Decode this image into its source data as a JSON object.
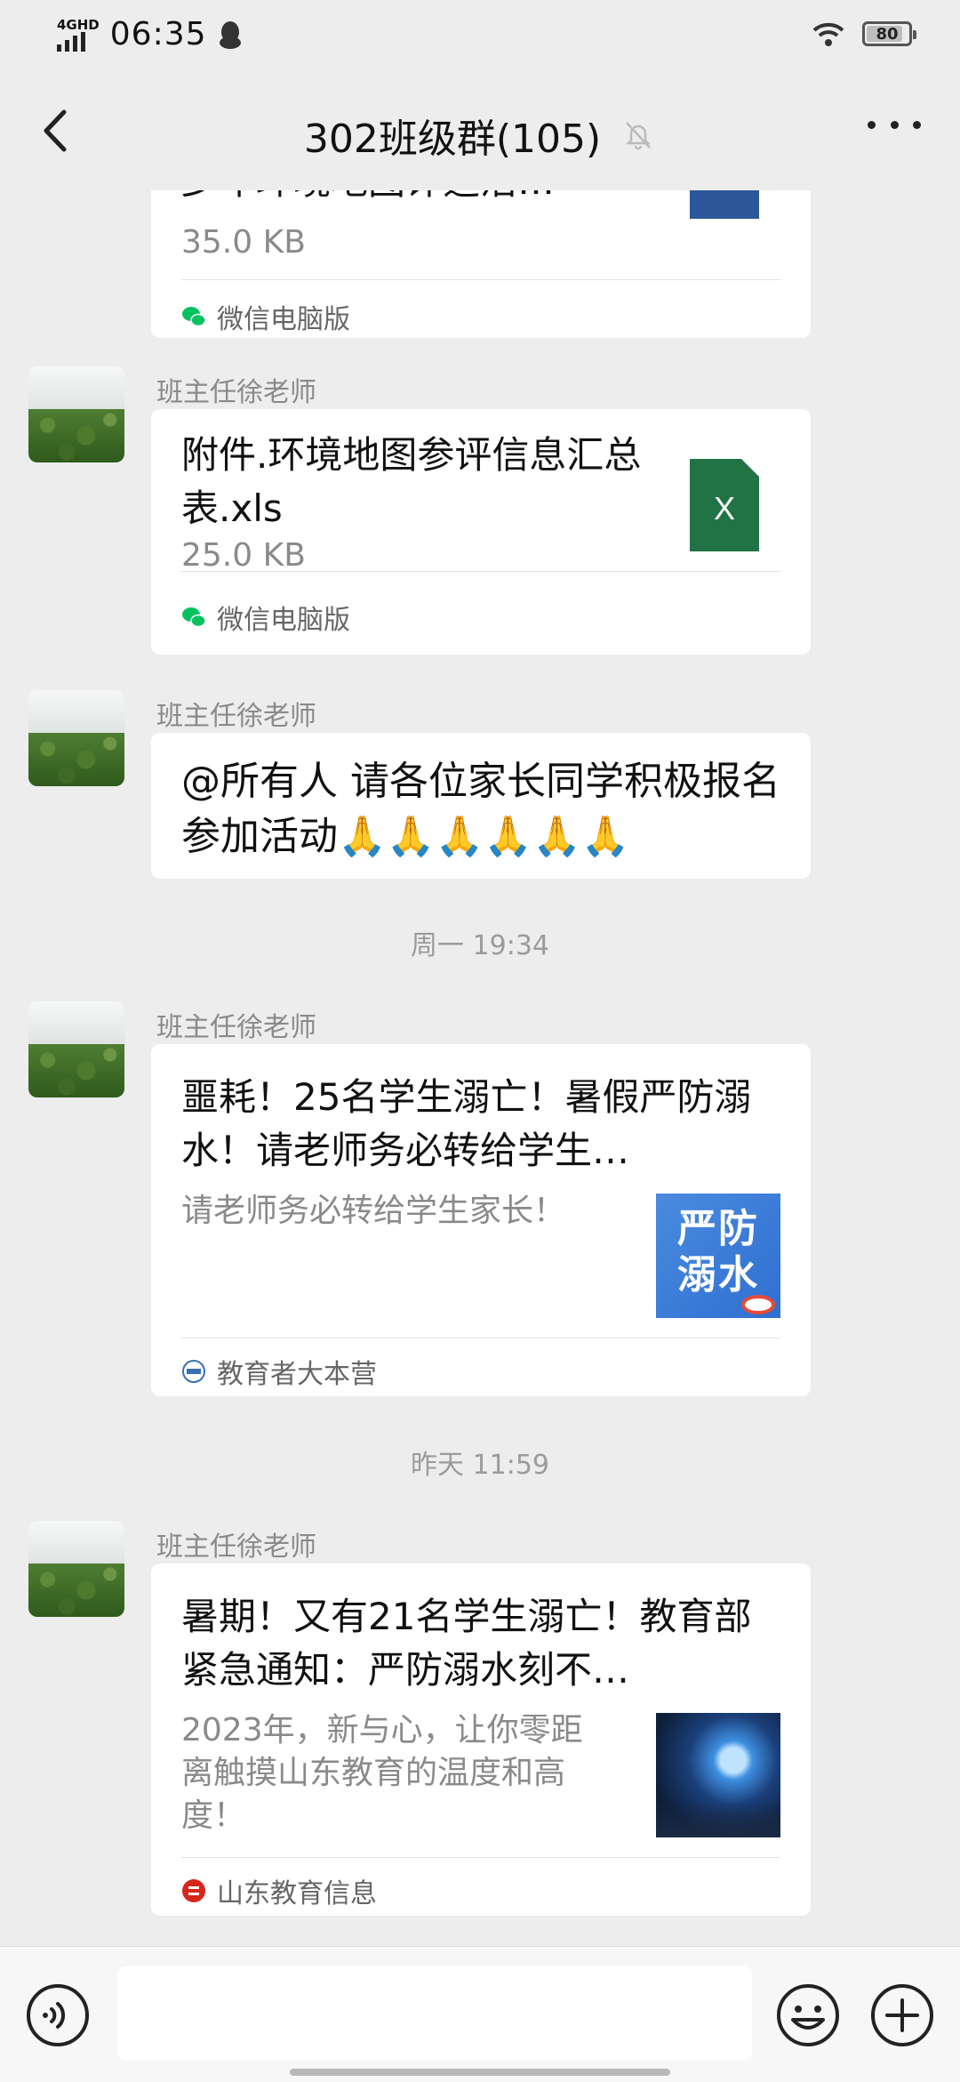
{
  "status_bar": {
    "network": "4G",
    "network_hd": "HD",
    "time": "06:35",
    "battery": "80"
  },
  "header": {
    "title": "302班级群(105)"
  },
  "messages": [
    {
      "title": "少年环境地图评选活…",
      "size": "35.0 KB",
      "source": "微信电脑版",
      "file_type": "W"
    },
    {
      "sender": "班主任徐老师",
      "title": "附件.环境地图参评信息汇总表.xls",
      "size": "25.0 KB",
      "source": "微信电脑版",
      "file_type": "X"
    },
    {
      "sender": "班主任徐老师",
      "text": "@所有人  请各位家长同学积极报名参加活动🙏🙏🙏🙏🙏🙏"
    },
    {
      "sender": "班主任徐老师",
      "title": "噩耗！25名学生溺亡！暑假严防溺水！请老师务必转给学生…",
      "desc": "请老师务必转给学生家长！",
      "thumb_text": "严防溺水",
      "source": "教育者大本营"
    },
    {
      "sender": "班主任徐老师",
      "title": "暑期！又有21名学生溺亡！教育部紧急通知：严防溺水刻不…",
      "desc": "2023年，新与心，让你零距离触摸山东教育的温度和高度！",
      "source": "山东教育信息"
    }
  ],
  "timestamps": [
    "周一 19:34",
    "昨天 11:59"
  ],
  "input": {
    "value": ""
  },
  "colors": {
    "background": "#ededed",
    "bubble": "#ffffff",
    "word_blue": "#2b579a",
    "excel_green": "#217346",
    "wechat_green": "#07c160"
  },
  "icons": [
    "back-arrow-icon",
    "mute-bell-icon",
    "more-icon",
    "voice-icon",
    "emoji-icon",
    "plus-icon",
    "wechat-icon",
    "word-file-icon",
    "excel-file-icon"
  ]
}
